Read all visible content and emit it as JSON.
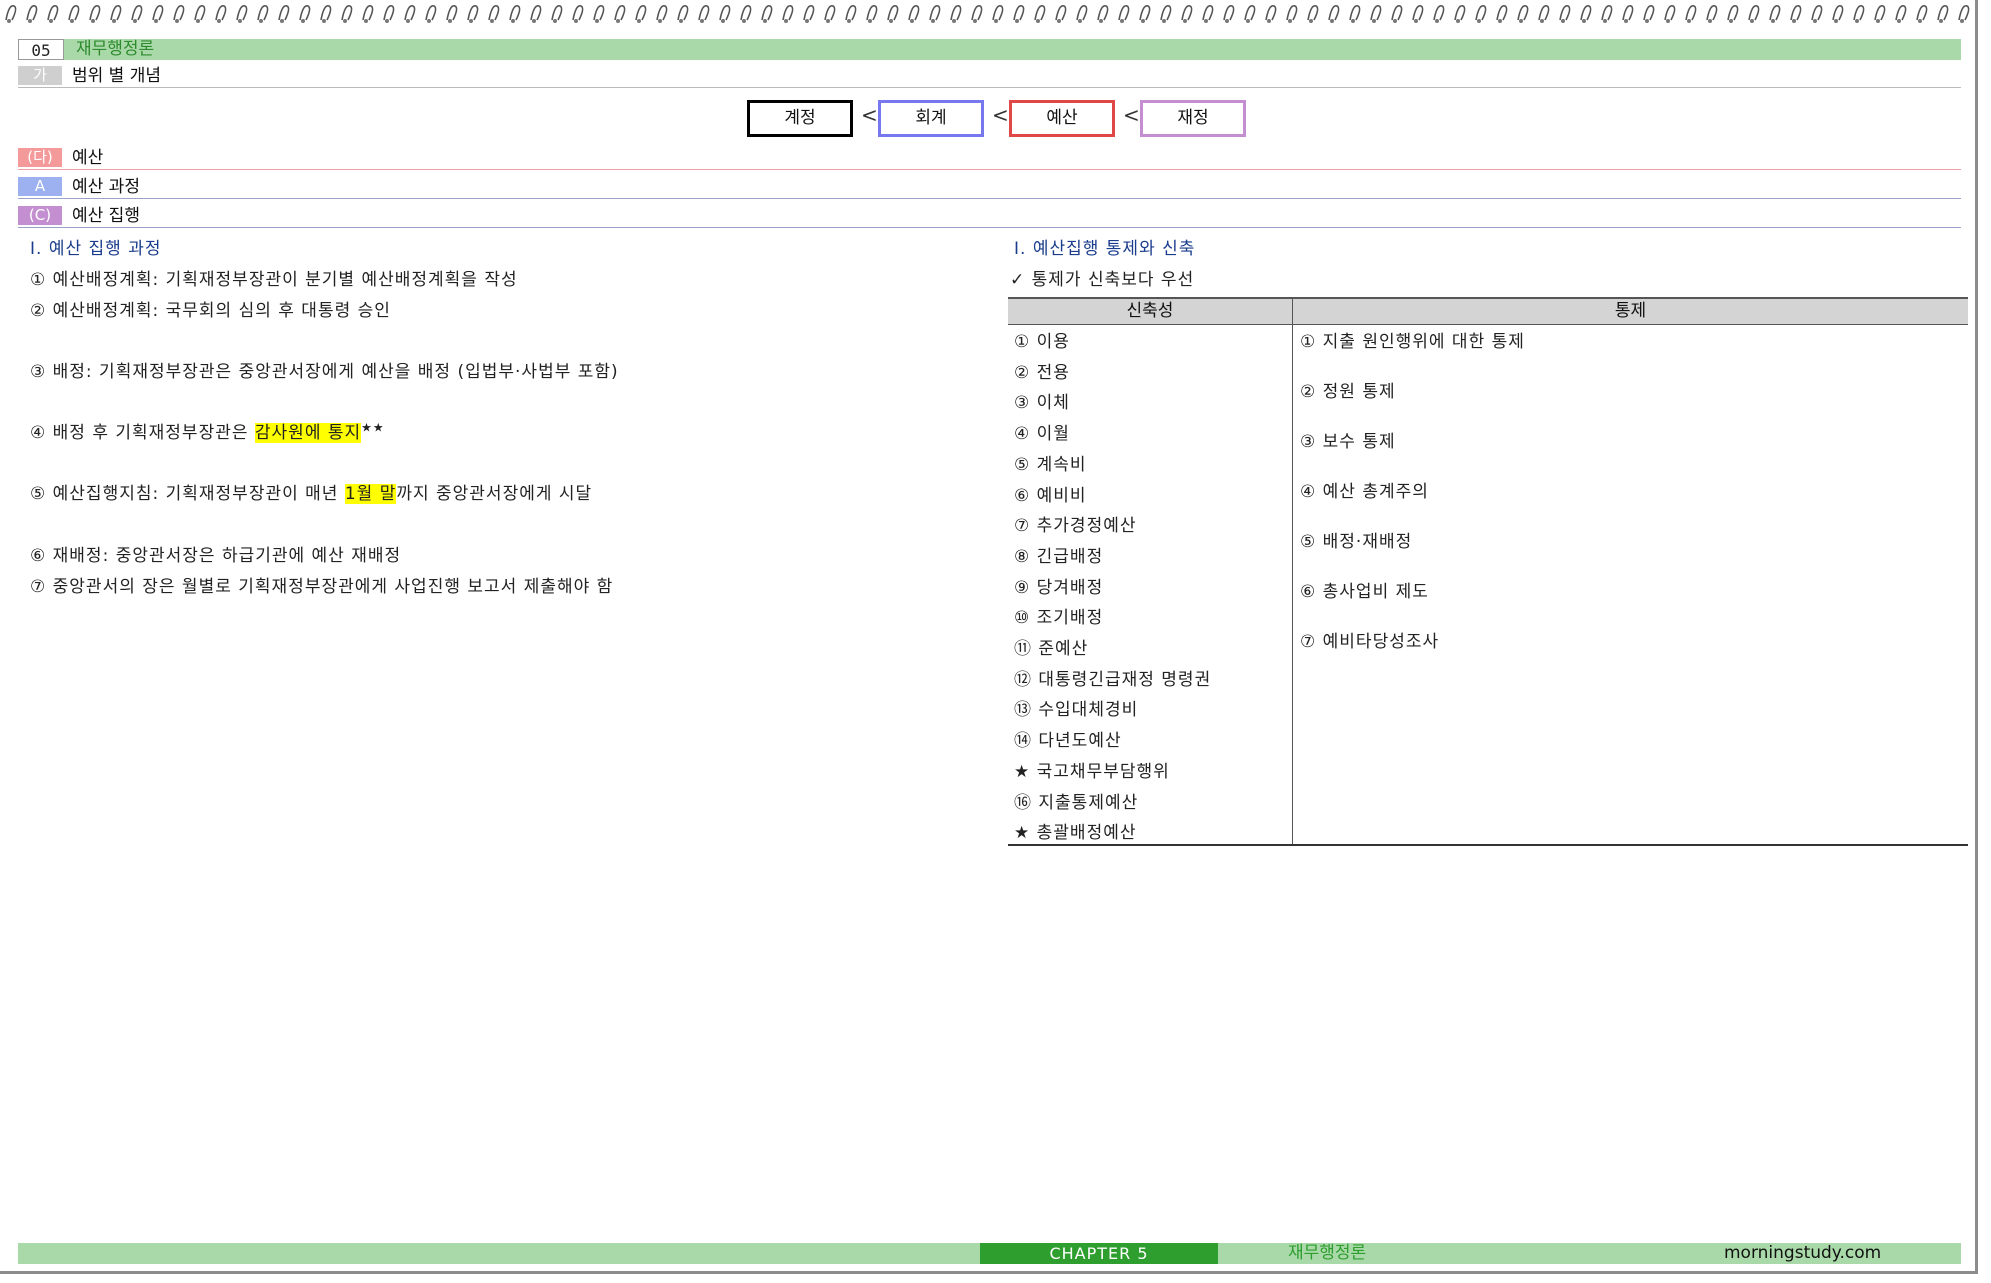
{
  "header": {
    "chapter_num": "05",
    "chapter_title": "재무행정론"
  },
  "sections": {
    "ga": {
      "tag": "가",
      "label": "범위 별 개념"
    },
    "da": {
      "tag": "(다)",
      "label": "예산"
    },
    "a": {
      "tag": "A",
      "label": "예산 과정"
    },
    "c": {
      "tag": "(C)",
      "label": "예산 집행"
    }
  },
  "concepts": {
    "items": [
      "계정",
      "회계",
      "예산",
      "재정"
    ],
    "separator": "<",
    "colors": [
      "#000000",
      "#7777ee",
      "#e04848",
      "#c48fd0"
    ]
  },
  "left": {
    "heading": "Ⅰ. 예산 집행 과정",
    "items": [
      {
        "text": "① 예산배정계획: 기획재정부장관이 분기별 예산배정계획을 작성"
      },
      {
        "text": "② 예산배정계획: 국무회의 심의 후 대통령 승인"
      },
      {
        "text": "③ 배정: 기획재정부장관은 중앙관서장에게 예산을 배정 (입법부·사법부 포함)"
      },
      {
        "pre": "④ 배정 후 기획재정부장관은 ",
        "highlight": "감사원에 통지",
        "post": "",
        "stars": "★★"
      },
      {
        "pre": "⑤ 예산집행지침: 기획재정부장관이 매년 ",
        "highlight": "1월 말",
        "post": "까지 중앙관서장에게 시달"
      },
      {
        "text": "⑥ 재배정: 중앙관서장은 하급기관에 예산 재배정"
      },
      {
        "text": "⑦ 중앙관서의 장은 월별로 기획재정부장관에게 사업진행 보고서 제출해야 함"
      }
    ]
  },
  "right": {
    "heading": "Ⅰ. 예산집행 통제와 신축",
    "note": "✓ 통제가 신축보다 우선",
    "table": {
      "headers": [
        "신축성",
        "통제"
      ],
      "flex": [
        "① 이용",
        "② 전용",
        "③ 이체",
        "④ 이월",
        "⑤ 계속비",
        "⑥ 예비비",
        "⑦ 추가경정예산",
        "⑧ 긴급배정",
        "⑨ 당겨배정",
        "⑩ 조기배정",
        "⑪ 준예산",
        "⑫ 대통령긴급재정 명령권",
        "⑬ 수입대체경비",
        "⑭ 다년도예산",
        "★ 국고채무부담행위",
        "⑯ 지출통제예산",
        "★ 총괄배정예산"
      ],
      "control": [
        "① 지출 원인행위에 대한 통제",
        "② 정원 통제",
        "③ 보수 통제",
        "④ 예산 총계주의",
        "⑤ 배정·재배정",
        "⑥ 총사업비 제도",
        "⑦ 예비타당성조사"
      ]
    }
  },
  "footer": {
    "chapter": "CHAPTER 5",
    "title": "재무행정론",
    "site": "morningstudy.com"
  }
}
